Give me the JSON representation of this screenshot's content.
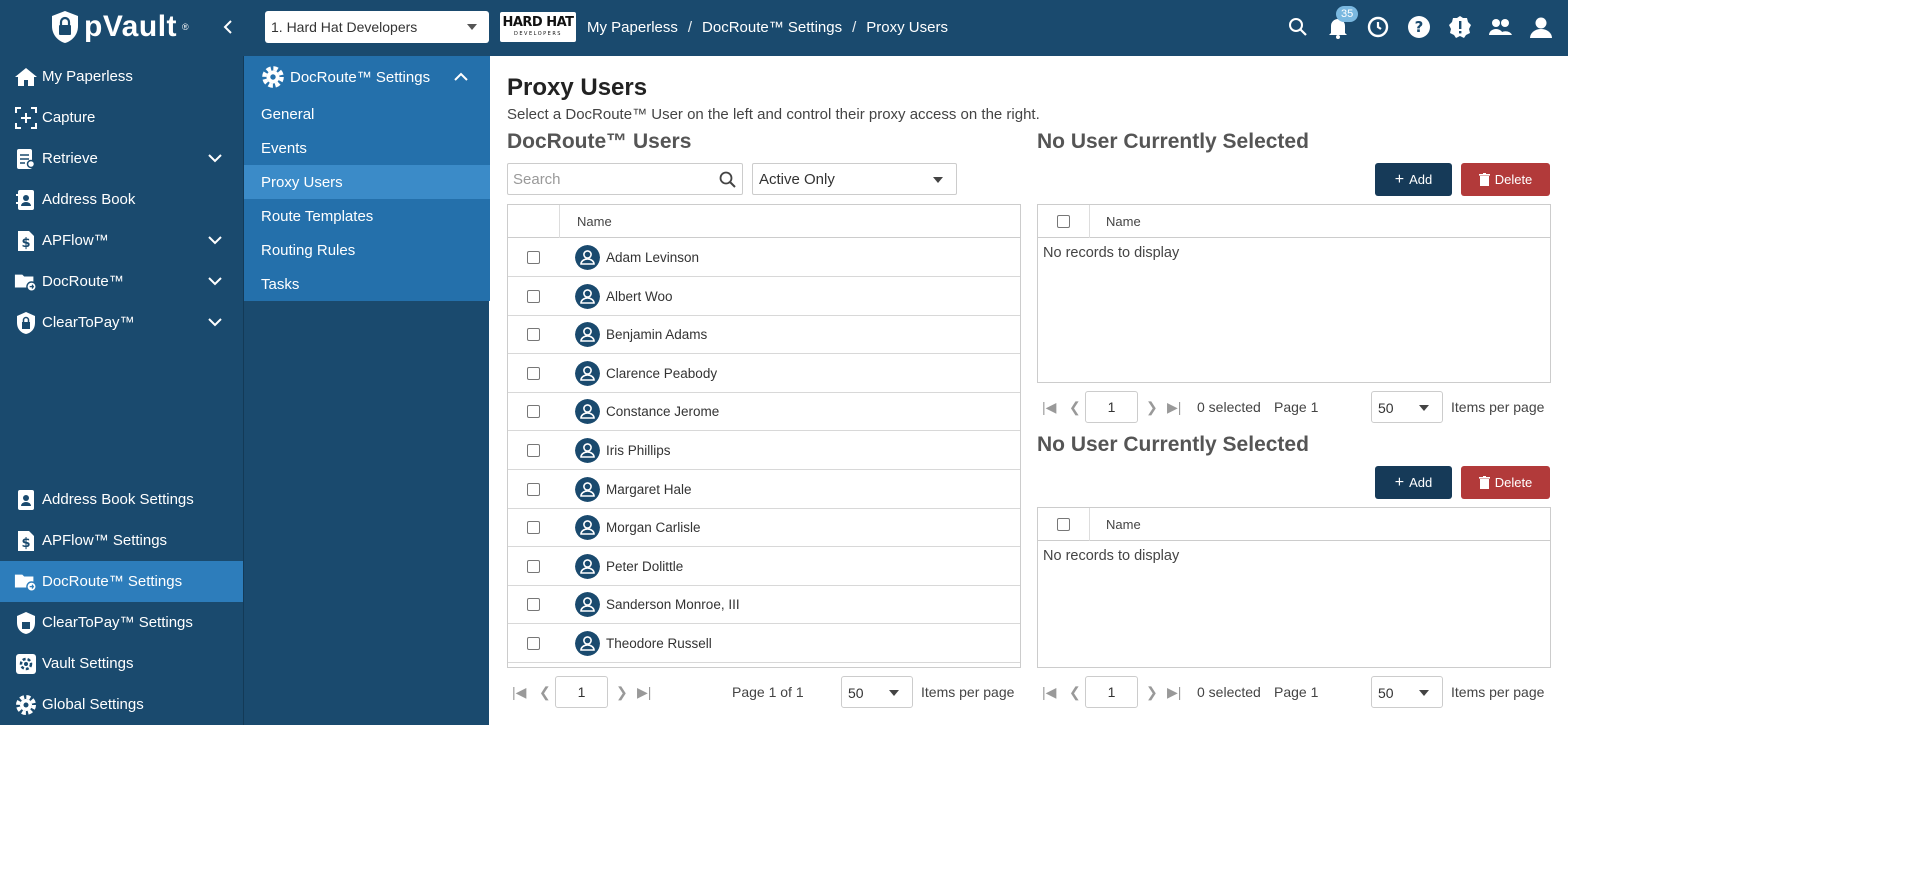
{
  "app": {
    "name": "pVault",
    "trademark": "®"
  },
  "org_selector": {
    "value": "1. Hard Hat Developers"
  },
  "org_logo": {
    "text": "HARD HAT",
    "subtext": "DEVELOPERS"
  },
  "breadcrumb": [
    "My Paperless",
    "/",
    "DocRoute™ Settings",
    "/",
    "Proxy Users"
  ],
  "notifications": {
    "count": "35"
  },
  "sidebar": {
    "items": [
      {
        "label": "My Paperless",
        "icon": "home-icon"
      },
      {
        "label": "Capture",
        "icon": "capture-icon"
      },
      {
        "label": "Retrieve",
        "icon": "retrieve-icon"
      },
      {
        "label": "Address Book",
        "icon": "address-book-icon"
      },
      {
        "label": "APFlow™",
        "icon": "dollar-doc-icon"
      },
      {
        "label": "DocRoute™",
        "icon": "folder-route-icon"
      },
      {
        "label": "ClearToPay™",
        "icon": "shield-lock-icon"
      }
    ],
    "settings": [
      {
        "label": "Address Book Settings"
      },
      {
        "label": "APFlow™ Settings"
      },
      {
        "label": "DocRoute™ Settings"
      },
      {
        "label": "ClearToPay™ Settings"
      },
      {
        "label": "Vault Settings"
      },
      {
        "label": "Global Settings"
      }
    ]
  },
  "subnav": {
    "header": "DocRoute™ Settings",
    "items": [
      "General",
      "Events",
      "Proxy Users",
      "Route Templates",
      "Routing Rules",
      "Tasks"
    ]
  },
  "main": {
    "title": "Proxy Users",
    "subtitle": "Select a DocRoute™ User on the left and control their proxy access on the right.",
    "users_title": "DocRoute™ Users",
    "search_placeholder": "Search",
    "filter_value": "Active Only",
    "name_col": "Name",
    "users": [
      "Adam Levinson",
      "Albert Woo",
      "Benjamin Adams",
      "Clarence Peabody",
      "Constance Jerome",
      "Iris Phillips",
      "Margaret Hale",
      "Morgan Carlisle",
      "Peter Dolittle",
      "Sanderson Monroe, III",
      "Theodore Russell"
    ],
    "users_pager": {
      "page": "1",
      "label": "Page 1 of 1",
      "per_page": "50",
      "per_page_label": "Items per page"
    },
    "panel1": {
      "title": "No User Currently Selected",
      "add": "Add",
      "delete": "Delete",
      "empty": "No records to display",
      "page": "1",
      "selected": "0 selected",
      "page_label": "Page 1",
      "per_page": "50",
      "per_page_label": "Items per page"
    },
    "panel2": {
      "title": "No User Currently Selected",
      "add": "Add",
      "delete": "Delete",
      "empty": "No records to display",
      "page": "1",
      "selected": "0 selected",
      "page_label": "Page 1",
      "per_page": "50",
      "per_page_label": "Items per page"
    }
  },
  "colors": {
    "navy": "#1a4a6e",
    "active_blue": "#2d7dbb",
    "delete_red": "#b23a3a"
  }
}
